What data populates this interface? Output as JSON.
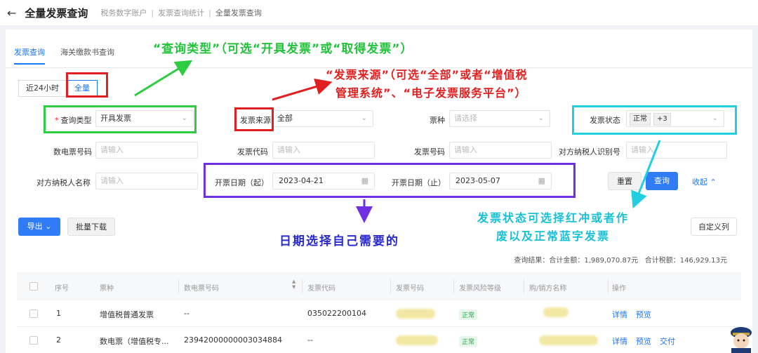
{
  "header": {
    "back_icon": "arrow-left-icon",
    "title": "全量发票查询",
    "breadcrumb": [
      "税务数字账户",
      "发票查询统计",
      "全量发票查询"
    ]
  },
  "tabs": [
    "发票查询",
    "海关缴款书查询"
  ],
  "segment": [
    "近24小时",
    "全量"
  ],
  "form": {
    "query_type_label": "查询类型",
    "query_type_value": "开具发票",
    "source_label": "发票来源",
    "source_value": "全部",
    "ticket_type_label": "票种",
    "ticket_type_placeholder": "请选择",
    "status_label": "发票状态",
    "status_tags": [
      "正常",
      "+3"
    ],
    "e_invoice_no_label": "数电票号码",
    "invoice_code_label": "发票代码",
    "invoice_no_label": "发票号码",
    "counter_tax_id_label": "对方纳税人识别号",
    "counter_name_label": "对方纳税人名称",
    "placeholder": "请输入",
    "date_start_label": "开票日期（起）",
    "date_start_value": "2023-04-21",
    "date_end_label": "开票日期（止）",
    "date_end_value": "2023-05-07",
    "reset_button": "重置",
    "query_button": "查询",
    "collapse_link": "收起"
  },
  "toolbar": {
    "export_button": "导出",
    "batch_download_button": "批量下载",
    "custom_columns_button": "自定义列"
  },
  "summary": {
    "label": "查询结果：",
    "total_amount_label": "合计金额：",
    "total_amount": "1,989,070.87元",
    "total_tax_label": "合计税额：",
    "total_tax": "146,929.13元"
  },
  "table": {
    "columns": [
      "序号",
      "票种",
      "数电票号码",
      "发票代码",
      "发票号码",
      "发票风险等级",
      "购/销方名称",
      "操作"
    ],
    "rows": [
      {
        "index": "1",
        "type": "增值税普通发票",
        "e_no": "--",
        "code": "035022200104",
        "risk": "正常",
        "ops": [
          "详情",
          "预览"
        ]
      },
      {
        "index": "2",
        "type": "数电票（增值税专...",
        "e_no": "23942000000003034884",
        "code": "--",
        "risk": "正常",
        "ops": [
          "详情",
          "预览",
          "交付"
        ]
      }
    ]
  },
  "annotations": {
    "green": "“查询类型”（可选“开具发票”或“取得发票”）",
    "red_line1": "“发票来源”（可选“全部”或者“增值税",
    "red_line2": "管理系统”、“电子发票服务平台”）",
    "purple": "日期选择自己需要的",
    "cyan_line1": "发票状态可选择红冲或者作",
    "cyan_line2": "废以及正常蓝字发票"
  }
}
